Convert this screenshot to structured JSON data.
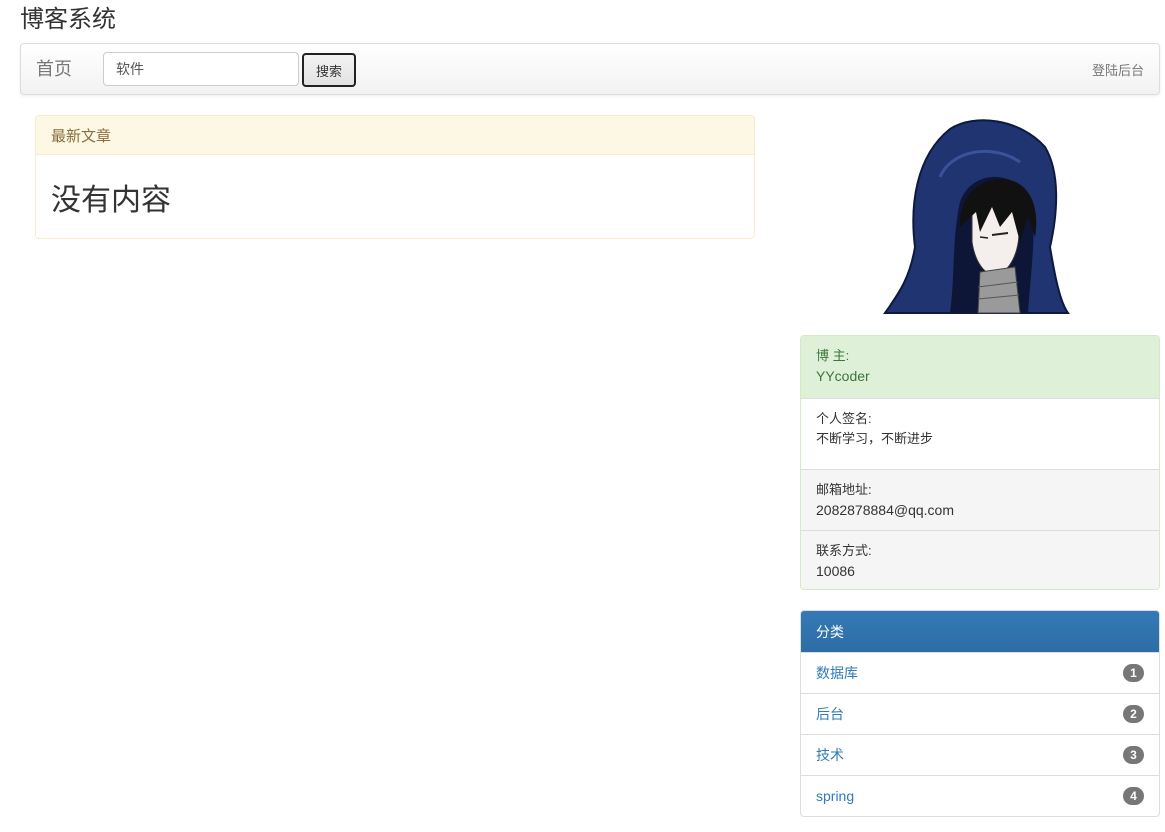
{
  "site": {
    "title": "博客系统"
  },
  "nav": {
    "home": "首页",
    "search_value": "软件",
    "search_button": "搜索",
    "login": "登陆后台"
  },
  "articles": {
    "heading": "最新文章",
    "empty_message": "没有内容"
  },
  "profile": {
    "owner_label": "博 主:",
    "owner_value": "YYcoder",
    "signature_label": "个人签名:",
    "signature_value": "不断学习，不断进步",
    "email_label": "邮箱地址:",
    "email_value": "2082878884@qq.com",
    "contact_label": "联系方式:",
    "contact_value": "10086"
  },
  "categories": {
    "heading": "分类",
    "items": [
      {
        "label": "数据库",
        "count": "1"
      },
      {
        "label": "后台",
        "count": "2"
      },
      {
        "label": "技术",
        "count": "3"
      },
      {
        "label": "spring",
        "count": "4"
      }
    ]
  },
  "colors": {
    "primary": "#337ab7",
    "warning_bg": "#fcf8e3",
    "success_bg": "#dff0d8",
    "badge": "#777777"
  }
}
